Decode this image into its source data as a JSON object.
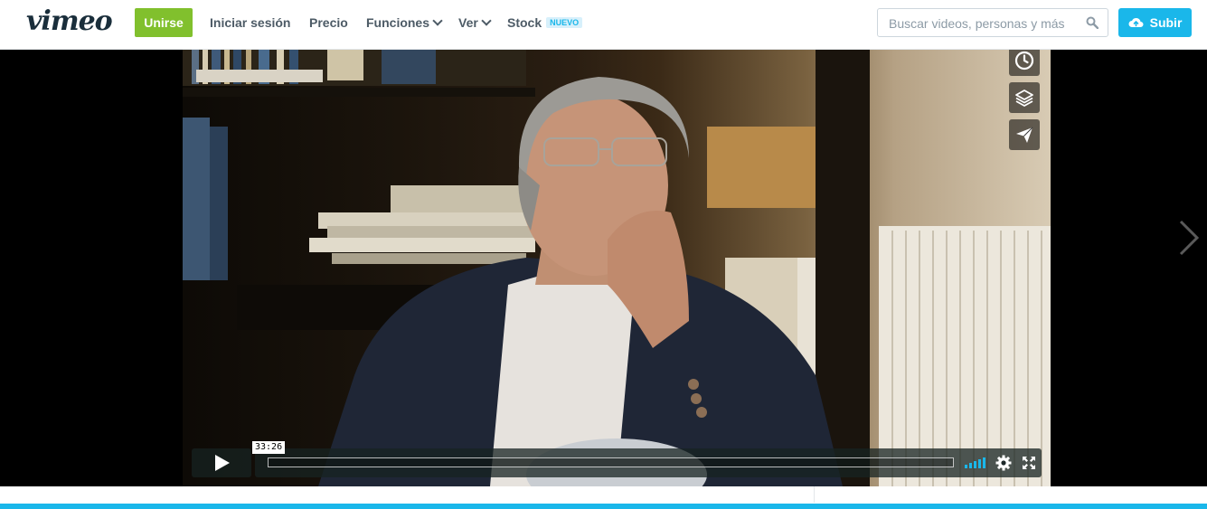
{
  "header": {
    "logo": "vimeo",
    "join_label": "Unirse",
    "nav": {
      "login": "Iniciar sesión",
      "pricing": "Precio",
      "features": "Funciones",
      "watch": "Ver",
      "stock": "Stock",
      "stock_badge": "NUEVO"
    },
    "search_placeholder": "Buscar videos, personas y más",
    "upload_label": "Subir"
  },
  "player": {
    "timecode": "33:26",
    "progress_fraction": 0,
    "volume_bars_active": 5,
    "side_buttons": [
      "clock-icon",
      "layers-icon",
      "paper-plane-icon"
    ]
  },
  "colors": {
    "brand": "#1ab7ea",
    "join": "#81c02d",
    "text": "#4d5b66",
    "logo": "#1a2e3b"
  }
}
